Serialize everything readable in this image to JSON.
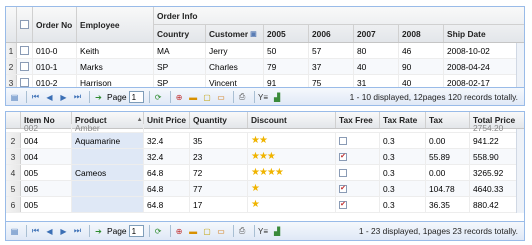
{
  "grid1": {
    "group_header": "Order Info",
    "headers": {
      "order_no": "Order No",
      "employee": "Employee",
      "country": "Country",
      "customer": "Customer",
      "y2005": "2005",
      "y2006": "2006",
      "y2007": "2007",
      "y2008": "2008",
      "ship_date": "Ship Date"
    },
    "rows": [
      {
        "num": "1",
        "order_no": "010-0",
        "employee": "Keith",
        "country": "MA",
        "customer": "Jerry",
        "y2005": "50",
        "y2006": "57",
        "y2007": "80",
        "y2008": "46",
        "ship_date": "2008-10-02"
      },
      {
        "num": "2",
        "order_no": "010-1",
        "employee": "Marks",
        "country": "SP",
        "customer": "Charles",
        "y2005": "79",
        "y2006": "37",
        "y2007": "40",
        "y2008": "90",
        "ship_date": "2008-04-24"
      },
      {
        "num": "3",
        "order_no": "010-2",
        "employee": "Harrison",
        "country": "SP",
        "customer": "Vincent",
        "y2005": "91",
        "y2006": "75",
        "y2007": "31",
        "y2008": "40",
        "ship_date": "2008-02-17"
      }
    ],
    "toolbar": {
      "page_label": "Page",
      "page_value": "1",
      "info": "1 - 10 displayed, 12pages 120 records totally."
    }
  },
  "grid2": {
    "headers": {
      "item_no": "Item No",
      "product": "Product",
      "unit_price": "Unit Price",
      "quantity": "Quantity",
      "discount": "Discount",
      "tax_free": "Tax Free",
      "tax_rate": "Tax Rate",
      "tax": "Tax",
      "total_price": "Total Price"
    },
    "partial_row": {
      "item_no": "002",
      "product": "Amber",
      "total_price": "2754.20"
    },
    "rows": [
      {
        "num": "2",
        "item_no": "004",
        "product": "Aquamarine",
        "unit_price": "32.4",
        "quantity": "35",
        "stars": "★★",
        "tax_free": false,
        "tax_rate": "0.3",
        "tax": "0.00",
        "total_price": "941.22"
      },
      {
        "num": "3",
        "item_no": "004",
        "product": "",
        "unit_price": "32.4",
        "quantity": "23",
        "stars": "★★★",
        "tax_free": true,
        "tax_rate": "0.3",
        "tax": "55.89",
        "total_price": "558.90"
      },
      {
        "num": "4",
        "item_no": "005",
        "product": "Cameos",
        "unit_price": "64.8",
        "quantity": "72",
        "stars": "★★★★",
        "tax_free": false,
        "tax_rate": "0.3",
        "tax": "0.00",
        "total_price": "3265.92"
      },
      {
        "num": "5",
        "item_no": "005",
        "product": "",
        "unit_price": "64.8",
        "quantity": "77",
        "stars": "★",
        "tax_free": true,
        "tax_rate": "0.3",
        "tax": "104.78",
        "total_price": "4640.33"
      },
      {
        "num": "6",
        "item_no": "005",
        "product": "",
        "unit_price": "64.8",
        "quantity": "17",
        "stars": "★",
        "tax_free": true,
        "tax_rate": "0.3",
        "tax": "36.35",
        "total_price": "880.42"
      }
    ],
    "toolbar": {
      "page_label": "Page",
      "page_value": "1",
      "info": "1 - 23 displayed, 1pages 23 records totally."
    }
  },
  "colors": {
    "border": "#99bbe8",
    "star": "#f0b400",
    "check": "#c03030",
    "selected_row": "#dfe8f6"
  }
}
